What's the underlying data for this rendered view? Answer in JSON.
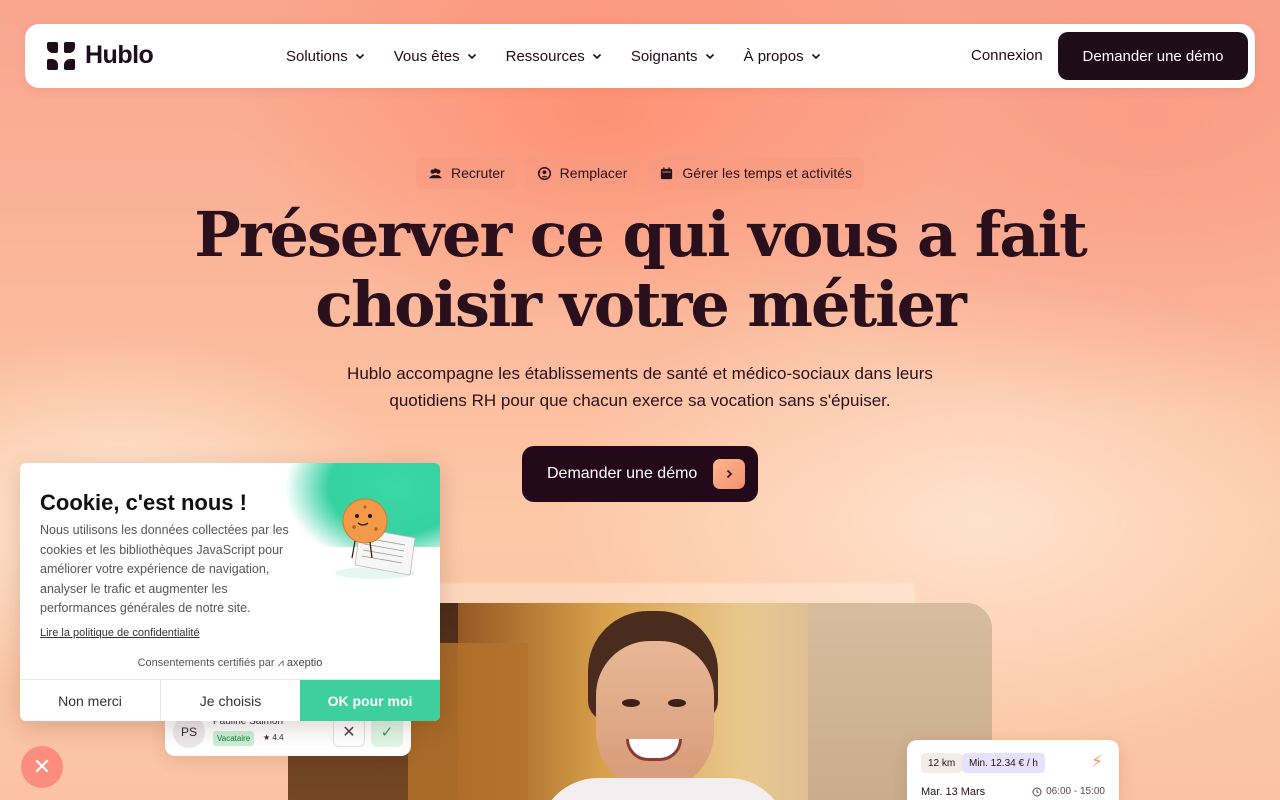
{
  "nav": {
    "logo_text": "Hublo",
    "items": [
      {
        "label": "Solutions"
      },
      {
        "label": "Vous êtes"
      },
      {
        "label": "Ressources"
      },
      {
        "label": "Soignants"
      },
      {
        "label": "À propos"
      }
    ],
    "login_label": "Connexion",
    "demo_label": "Demander une démo"
  },
  "hero": {
    "pills": [
      {
        "label": "Recruter",
        "icon": "users-icon"
      },
      {
        "label": "Remplacer",
        "icon": "swap-user-icon"
      },
      {
        "label": "Gérer les temps et activités",
        "icon": "calendar-icon"
      }
    ],
    "title_line1": "Préserver ce qui vous a fait",
    "title_line2": "choisir votre métier",
    "subtitle_line1": "Hublo accompagne les établissements de santé et médico-sociaux dans leurs",
    "subtitle_line2": "quotidiens RH pour que chacun exerce sa vocation sans s'épuiser.",
    "cta_label": "Demander une démo"
  },
  "candidate_card": {
    "initials": "PS",
    "name": "Pauline Saimon",
    "tag": "Vacataire",
    "rating": "★ 4.4"
  },
  "schedule_card": {
    "distance": "12 km",
    "min_rate": "Min. 12.34 € / h",
    "date": "Mar. 13 Mars",
    "time": "06:00 - 15:00"
  },
  "cookie": {
    "title": "Cookie, c'est nous !",
    "text": "Nous utilisons les données collectées par les cookies et les bibliothèques JavaScript pour améliorer votre expérience de navigation, analyser le trafic et augmenter les performances générales de notre site.",
    "policy_link": "Lire la politique de confidentialité",
    "certified": "Consentements certifiés par",
    "certifier": "axeptio",
    "btn_refuse": "Non merci",
    "btn_choose": "Je choisis",
    "btn_accept": "OK pour moi"
  },
  "colors": {
    "brand_dark": "#1e0c18",
    "accept_green": "#3ecf9e",
    "cta_arrow": "#f58f73"
  }
}
